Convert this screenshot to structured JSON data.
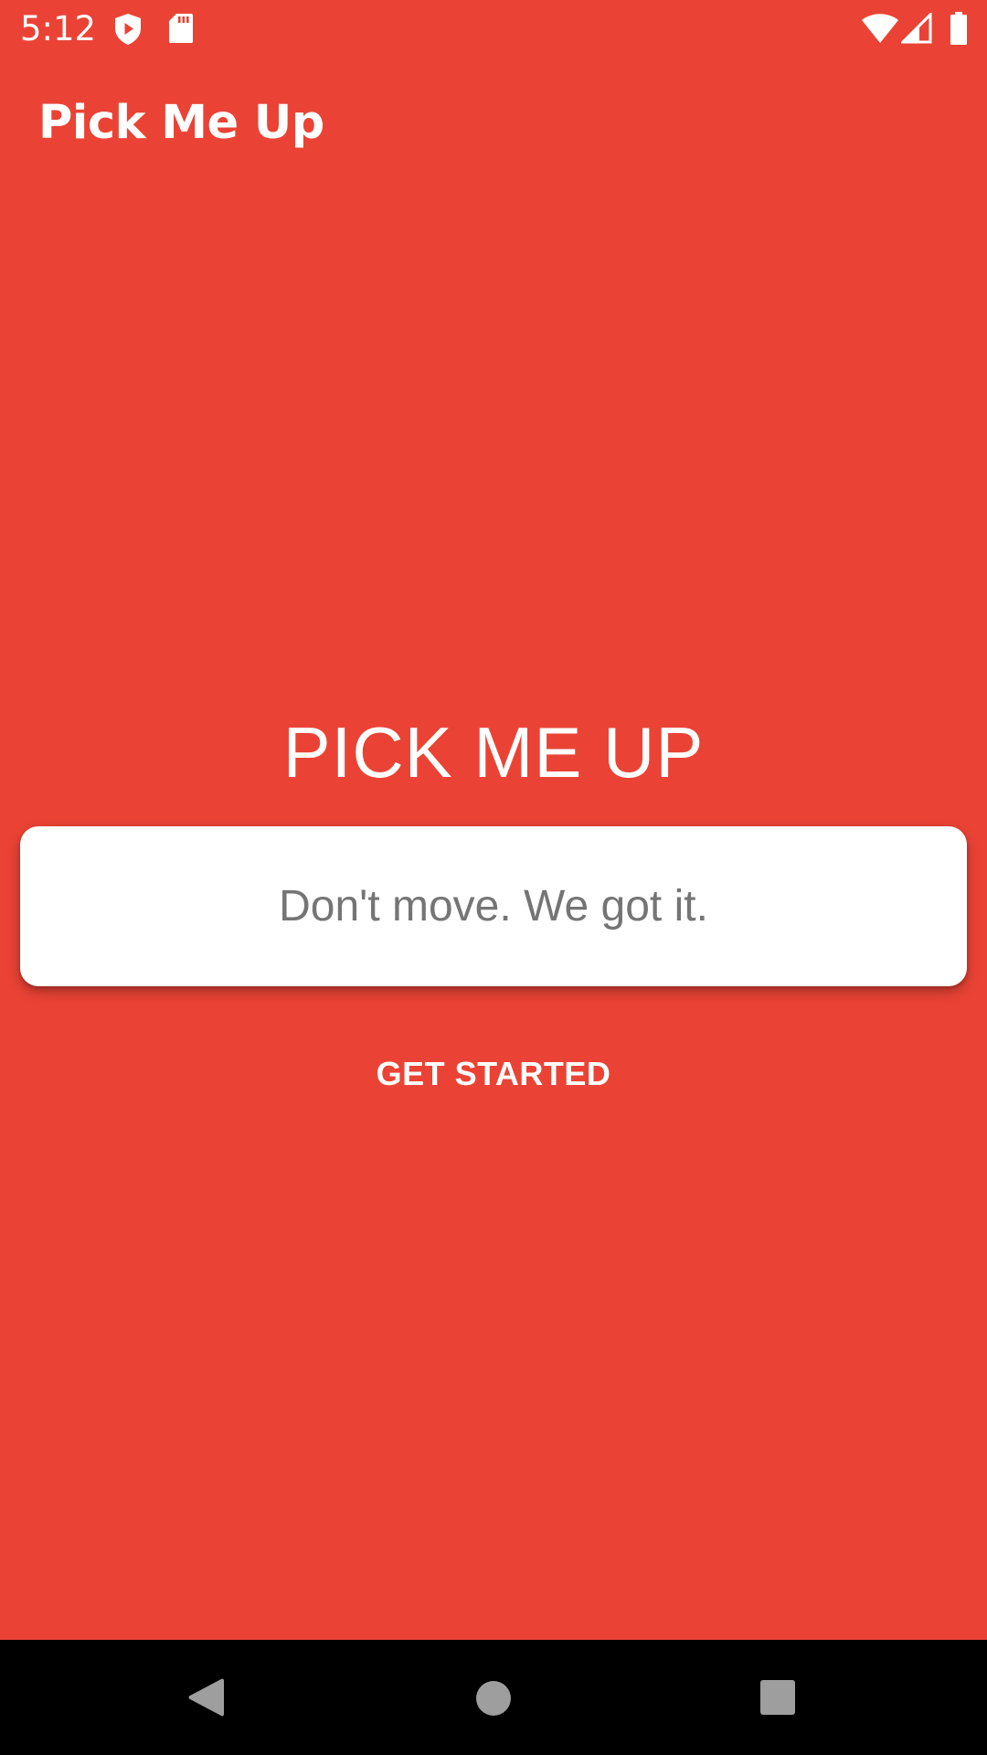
{
  "colors": {
    "background": "#EA4335",
    "on_background": "#FFFFFF",
    "card": "#FFFFFF",
    "card_text": "#757575",
    "nav_bar": "#000000",
    "nav_icon": "#9E9E9E"
  },
  "status_bar": {
    "time": "5:12",
    "icons": [
      "shield-play-icon",
      "sd-card-icon",
      "wifi-icon",
      "cellular-signal-icon",
      "battery-icon"
    ]
  },
  "app_bar": {
    "title": "Pick Me Up"
  },
  "main": {
    "heading": "PICK ME UP",
    "tagline": "Don't move. We got it.",
    "get_started_label": "GET STARTED"
  },
  "nav_bar": {
    "buttons": [
      "back-icon",
      "home-icon",
      "recents-icon"
    ]
  }
}
